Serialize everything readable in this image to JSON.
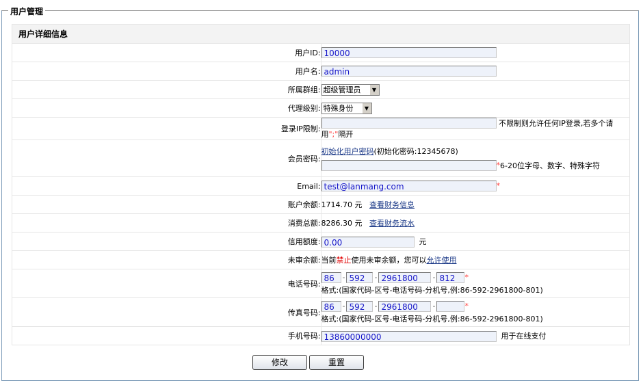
{
  "legend": "用户管理",
  "section_title": "用户详细信息",
  "fields": {
    "user_id": {
      "label": "用户ID:",
      "value": "10000"
    },
    "username": {
      "label": "用户名:",
      "value": "admin"
    },
    "group": {
      "label": "所属群组:",
      "selected": "超级管理员"
    },
    "agent_level": {
      "label": "代理级别:",
      "selected": "特殊身份"
    },
    "ip_limit": {
      "label": "登录IP限制:",
      "value": "",
      "hint_pre": "不限制则允许任何IP登录,若多个请用",
      "hint_sep": "\";\"",
      "hint_post": "隔开"
    },
    "password": {
      "label": "会员密码:",
      "reset_link": "初始化用户密码",
      "reset_note": "(初始化密码:12345678)",
      "value": "",
      "rule": "6-20位字母、数字、特殊字符"
    },
    "email": {
      "label": "Email:",
      "value": "test@lanmang.com"
    },
    "balance": {
      "label": "账户余额:",
      "amount": "1714.70 元",
      "link": "查看财务信息"
    },
    "total_spent": {
      "label": "消费总额:",
      "amount": "8286.30 元",
      "link": "查看财务流水"
    },
    "credit": {
      "label": "信用额度:",
      "value": "0.00",
      "unit": "元"
    },
    "unaudited": {
      "label": "未审余额:",
      "pre": "当前",
      "status": "禁止",
      "mid": "使用未审余额，您可以",
      "link": "允许使用"
    },
    "phone": {
      "label": "电话号码:",
      "country": "86",
      "area": "592",
      "number": "2961800",
      "ext": "812",
      "format": "格式:(国家代码-区号-电话号码-分机号,例:86-592-2961800-801)"
    },
    "fax": {
      "label": "传真号码:",
      "country": "86",
      "area": "592",
      "number": "2961800",
      "ext": "",
      "format": "格式:(国家代码-区号-电话号码-分机号,例:86-592-2961800-801)"
    },
    "mobile": {
      "label": "手机号码:",
      "value": "13860000000",
      "note": "用于在线支付"
    }
  },
  "required_mark": "*",
  "dash": "-",
  "buttons": {
    "modify": "修改",
    "reset": "重置"
  },
  "colors": {
    "required": "#ff3b3b",
    "forbidden": "#e00000",
    "link": "#1c3a88",
    "input_bg": "#eef2fa",
    "input_text": "#1515c8"
  }
}
